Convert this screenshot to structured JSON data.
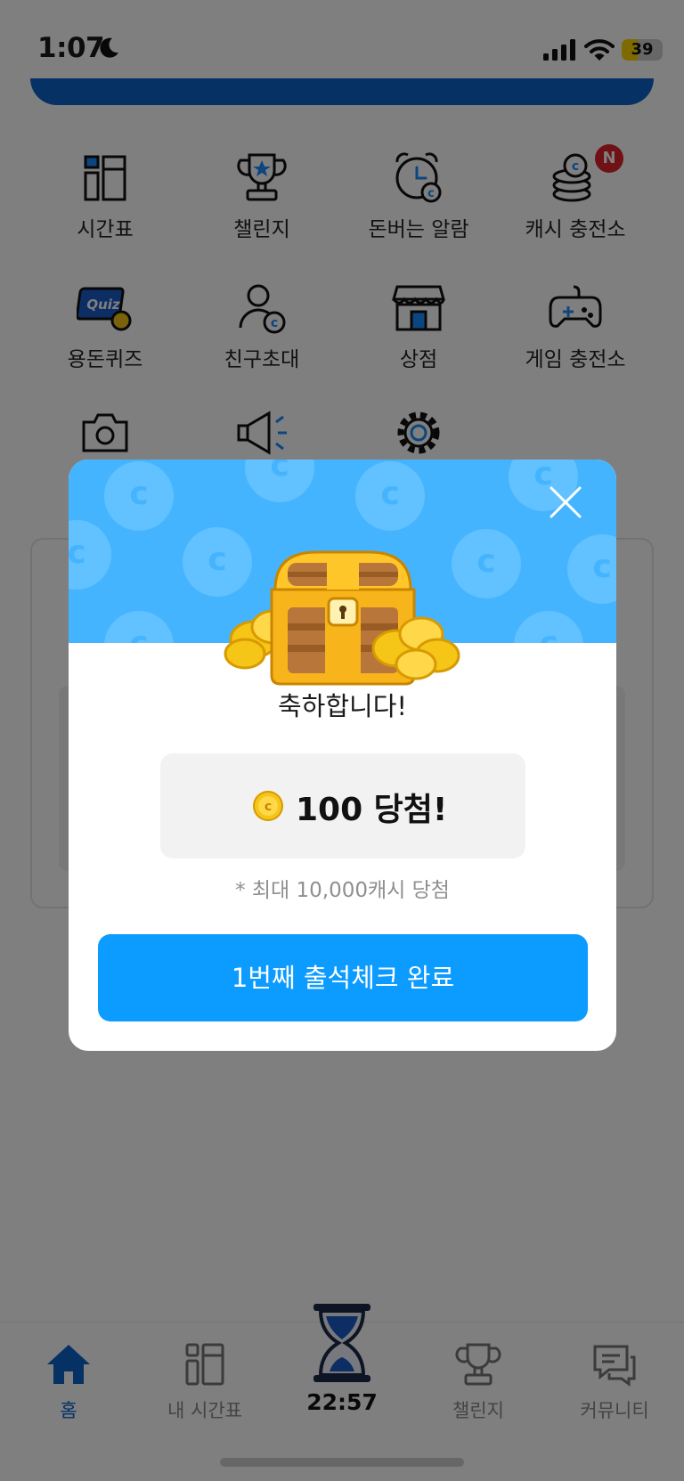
{
  "status_bar": {
    "time": "1:07",
    "battery": "39"
  },
  "menu": {
    "items": [
      {
        "label": "시간표",
        "icon": "timetable-icon"
      },
      {
        "label": "챌린지",
        "icon": "trophy-icon"
      },
      {
        "label": "돈버는 알람",
        "icon": "alarm-clock-icon"
      },
      {
        "label": "캐시 충전소",
        "icon": "coin-stack-icon",
        "badge": "N"
      },
      {
        "label": "용돈퀴즈",
        "icon": "quiz-icon",
        "icon_text": "Quiz"
      },
      {
        "label": "친구초대",
        "icon": "invite-friend-icon"
      },
      {
        "label": "상점",
        "icon": "store-icon"
      },
      {
        "label": "게임 충전소",
        "icon": "gamepad-icon"
      },
      {
        "label": "",
        "icon": "camera-icon"
      },
      {
        "label": "",
        "icon": "megaphone-icon"
      },
      {
        "label": "",
        "icon": "gear-icon"
      }
    ]
  },
  "modal": {
    "congrats": "축하합니다!",
    "prize": "100 당첨!",
    "note": "* 최대 10,000캐시 당첨",
    "confirm_label": "1번째 출석체크 완료"
  },
  "bottom_nav": {
    "items": [
      {
        "label": "홈",
        "icon": "home-icon",
        "active": true
      },
      {
        "label": "내 시간표",
        "icon": "timetable-icon"
      },
      {
        "label": "챌린지",
        "icon": "trophy-icon"
      },
      {
        "label": "커뮤니티",
        "icon": "chat-icon"
      }
    ],
    "timer": "22:57"
  },
  "colors": {
    "primary": "#0c9bff",
    "brand_dark": "#0a63c9",
    "banner": "#45b4ff",
    "badge": "#e0232b",
    "coin": "#f5c518"
  }
}
